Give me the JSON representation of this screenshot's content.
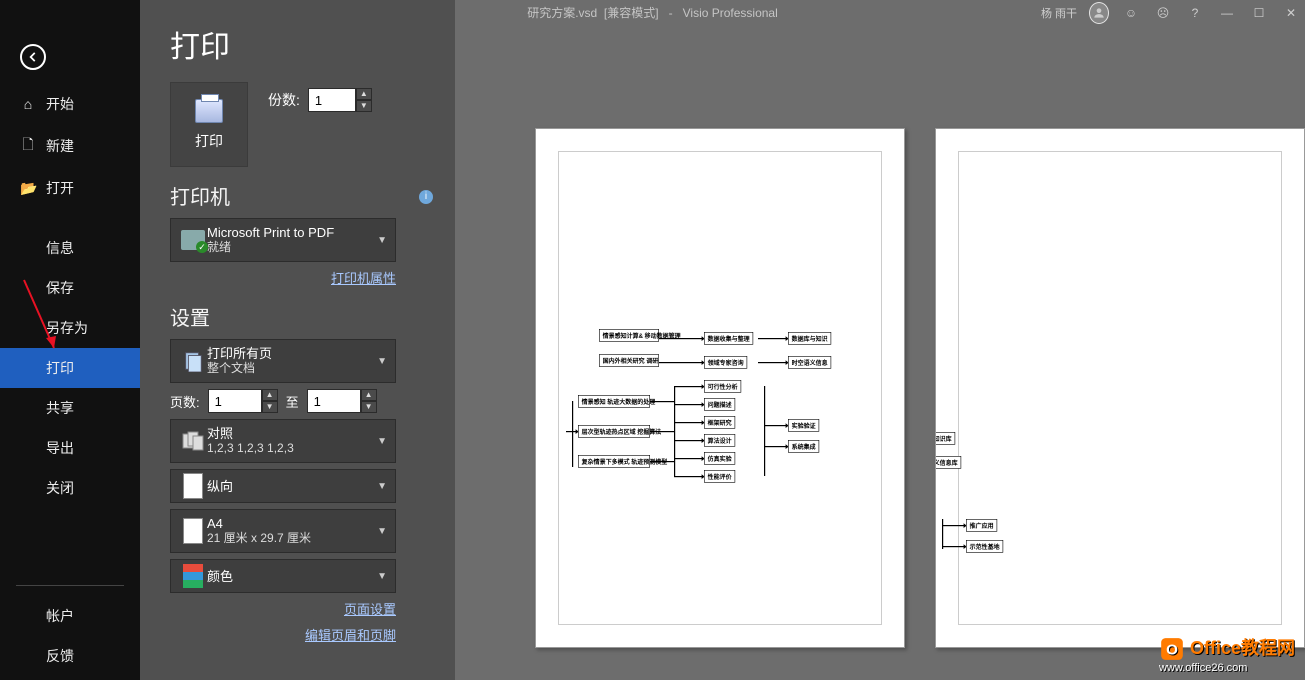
{
  "titlebar": {
    "filename": "研究方案.vsd",
    "mode": "[兼容模式]",
    "sep": "-",
    "app": "Visio Professional",
    "user": "杨 雨干"
  },
  "sidebar": {
    "home": "开始",
    "new": "新建",
    "open": "打开",
    "info": "信息",
    "save": "保存",
    "saveas": "另存为",
    "print": "打印",
    "share": "共享",
    "export": "导出",
    "close": "关闭",
    "account": "帐户",
    "feedback": "反馈"
  },
  "panel": {
    "title": "打印",
    "print_btn": "打印",
    "copies_label": "份数:",
    "copies_value": "1",
    "printer_heading": "打印机",
    "printer_name": "Microsoft Print to PDF",
    "printer_status": "就绪",
    "printer_props": "打印机属性",
    "settings_heading": "设置",
    "scope_title": "打印所有页",
    "scope_sub": "整个文档",
    "pages_label": "页数:",
    "page_from": "1",
    "to_label": "至",
    "page_to": "1",
    "collate_title": "对照",
    "collate_sub": "1,2,3    1,2,3    1,2,3",
    "orient": "纵向",
    "paper_title": "A4",
    "paper_sub": "21 厘米 x 29.7 厘米",
    "color": "颜色",
    "page_setup": "页面设置",
    "header_footer": "编辑页眉和页脚"
  },
  "diagram": {
    "b1": "情景感知计算&\n移动数据管理",
    "b2": "国内外相关研究\n调研",
    "b3": "数据收集与整理",
    "b4": "领域专家咨询",
    "b5": "数据库与知识",
    "b6": "时空语义信息",
    "b7": "情景感知\n轨迹大数据的处理",
    "b8": "层次型轨迹热点区域\n挖掘算法",
    "b9": "复杂情景下多模式\n轨迹预测模型",
    "b10": "可行性分析",
    "b11": "问题描述",
    "b12": "框架研究",
    "b13": "算法设计",
    "b14": "仿真实验",
    "b15": "性能评价",
    "b16": "实验验证",
    "b17": "系统集成",
    "d1": "知识库",
    "d2": "义信息库",
    "d3": "推广应用",
    "d4": "示范性基地"
  },
  "watermark": {
    "brand": "Office教程网",
    "url": "www.office26.com"
  }
}
